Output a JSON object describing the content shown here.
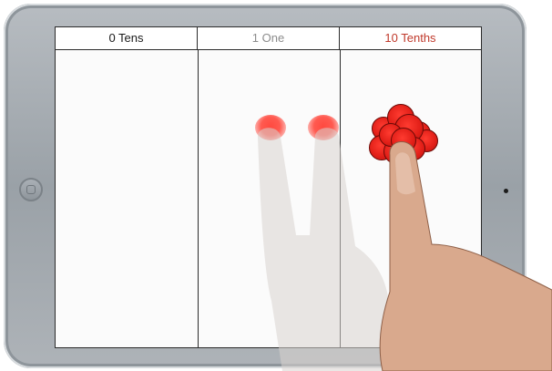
{
  "columns": [
    {
      "label": "0 Tens",
      "color": "#1a1a1a"
    },
    {
      "label": "1 One",
      "color": "#8c8c8c"
    },
    {
      "label": "10 Tenths",
      "color": "#c0392b"
    }
  ],
  "colors": {
    "marker_red": "#e01e17",
    "tablet_frame": "#9aa1a7",
    "screen_bg": "#fbfbfb"
  },
  "icons": {
    "home": "home-button-icon",
    "camera": "camera-icon"
  }
}
